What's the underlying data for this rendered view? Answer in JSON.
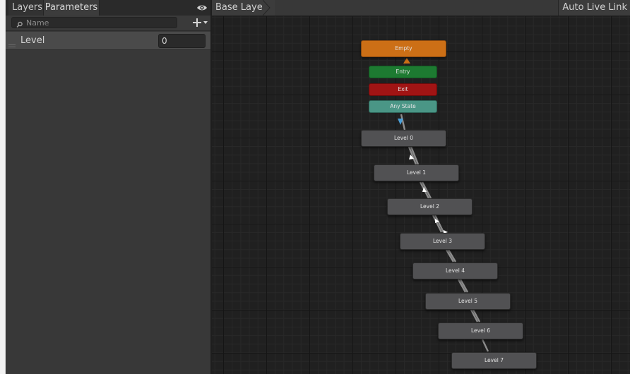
{
  "left_panel": {
    "tabs": [
      {
        "label": "Layers"
      },
      {
        "label": "Parameters"
      }
    ],
    "search": {
      "placeholder": "Name"
    },
    "parameters": [
      {
        "name": "Level",
        "value": "0"
      }
    ]
  },
  "graph": {
    "breadcrumb": "Base Layer",
    "auto_live_link": "Auto Live Link",
    "states": {
      "empty": "Empty",
      "entry": "Entry",
      "exit": "Exit",
      "any_state": "Any State",
      "level_0": "Level 0",
      "level_1": "Level 1",
      "level_2": "Level 2",
      "level_3": "Level 3",
      "level_4": "Level 4",
      "level_5": "Level 5",
      "level_6": "Level 6",
      "level_7": "Level 7"
    }
  },
  "colors": {
    "default_state": "#cc6f16",
    "entry": "#1d7a31",
    "exit": "#a11414",
    "any_state": "#4a9686",
    "state": "#515153",
    "grid_background": "#202020"
  },
  "icons": {
    "visibility": "eye-icon",
    "search": "search-icon",
    "add": "plus-icon",
    "dropdown": "chevron-down-icon",
    "drag": "drag-handle-icon",
    "breadcrumb": "chevron-right-icon"
  }
}
